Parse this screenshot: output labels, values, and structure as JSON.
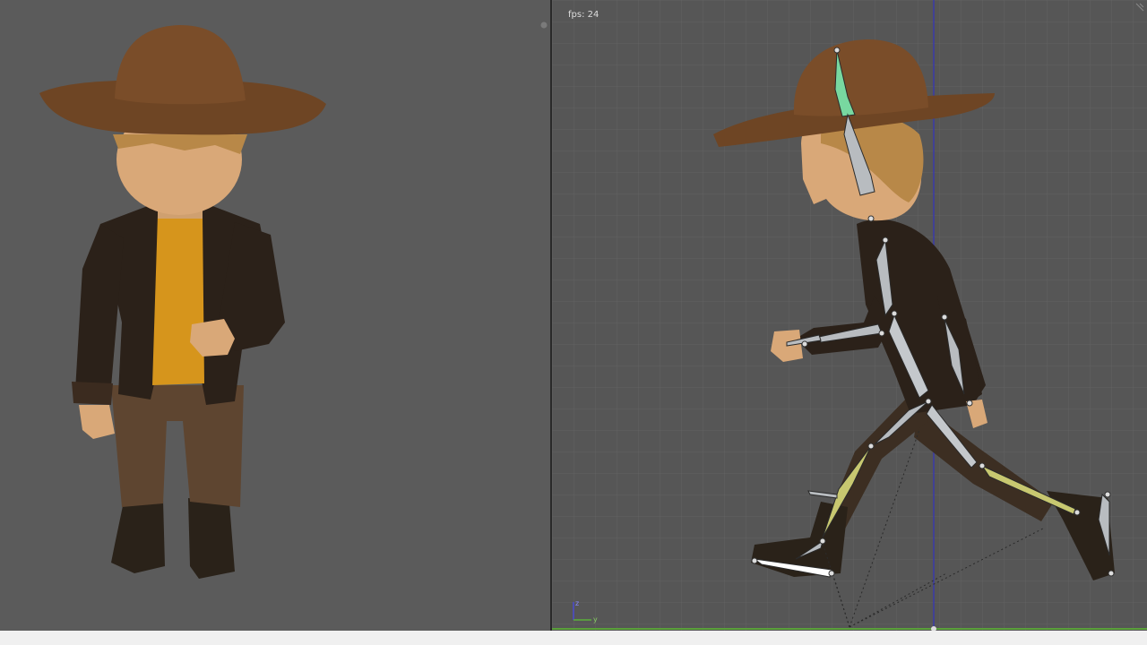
{
  "viewport_left": {
    "name": "camera-view",
    "background": "#5b5b5b"
  },
  "viewport_right": {
    "name": "armature-view",
    "background": "#565656",
    "fps_label": "fps: 24",
    "axis_labels": {
      "z": "z",
      "y": "y"
    },
    "grid_color": "#626262",
    "vertical_axis_color": "#3a3aa8",
    "horizontal_axis_color": "#5aa03a"
  },
  "colors": {
    "hat": "#6e4524",
    "skin": "#d9a878",
    "hair": "#b88848",
    "jacket": "#2b2119",
    "shirt": "#d6951c",
    "pants": "#5e4530",
    "boots": "#2a2219",
    "bone_default": "#b8bcc0",
    "bone_selected_head": "#78d8a0",
    "bone_leg_yellow": "#c8c870"
  },
  "icons": {
    "corner": "corner-resize-icon",
    "header": "viewport-corner-widget-icon",
    "gizmo": "axis-gizmo-icon"
  }
}
